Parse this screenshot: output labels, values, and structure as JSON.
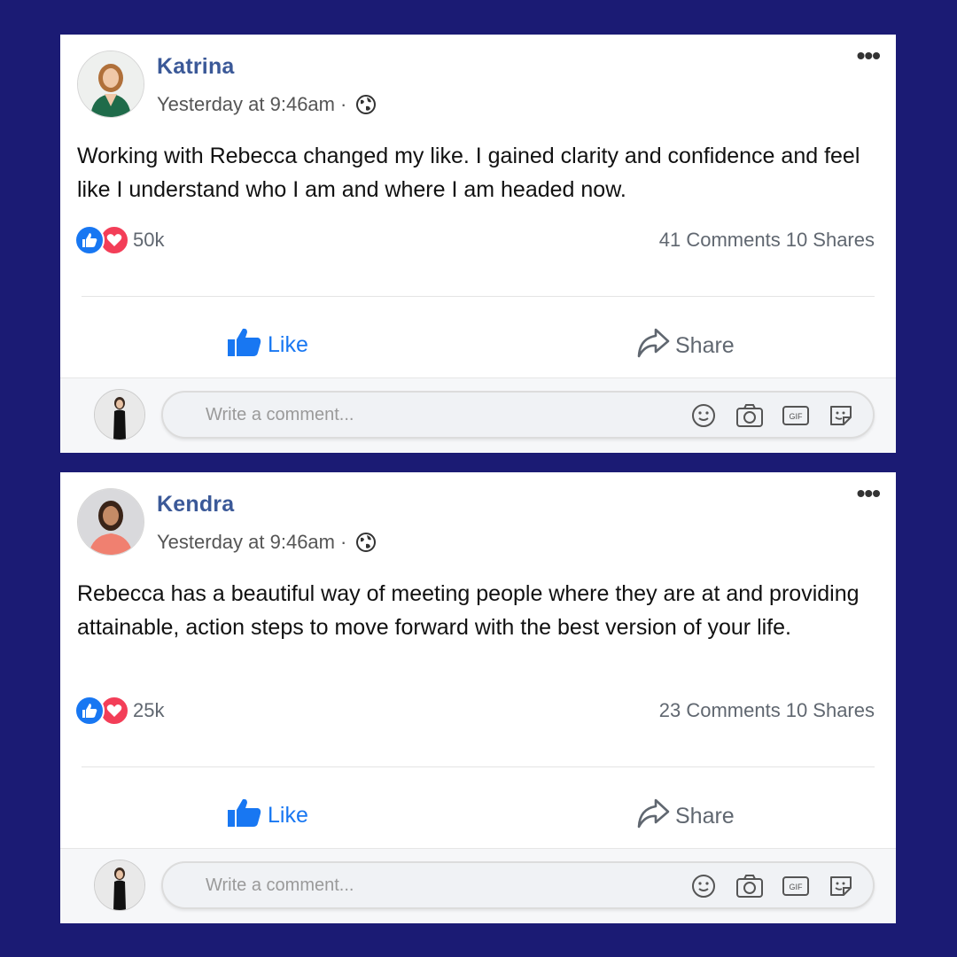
{
  "posts": [
    {
      "author": "Katrina",
      "timestamp": "Yesterday at 9:46am",
      "separator": "·",
      "text": "Working with Rebecca changed my like. I gained clarity and confidence and feel like I understand who I am and where I am headed now.",
      "reaction_count": "50k",
      "comments": "41 Comments",
      "shares": "10 Shares",
      "like_label": "Like",
      "share_label": "Share",
      "comment_placeholder": "Write a comment...",
      "more_label": "•••"
    },
    {
      "author": "Kendra",
      "timestamp": "Yesterday at 9:46am",
      "separator": "·",
      "text": "Rebecca has a beautiful way of meeting people where they are at and providing attainable, action steps to move forward with the best version of your life.",
      "reaction_count": "25k",
      "comments": "23 Comments",
      "shares": "10 Shares",
      "like_label": "Like",
      "share_label": "Share",
      "comment_placeholder": "Write a comment...",
      "more_label": "•••"
    }
  ],
  "icons": [
    "globe-icon",
    "like-reaction-icon",
    "love-reaction-icon",
    "thumbs-up-icon",
    "share-arrow-icon",
    "emoji-icon",
    "camera-icon",
    "gif-icon",
    "sticker-icon",
    "more-options-icon"
  ],
  "colors": {
    "background": "#1b1b74",
    "card": "#ffffff",
    "author_name": "#3b5998",
    "like_blue": "#1877f2",
    "love_red": "#f33e58",
    "muted_text": "#606770"
  }
}
